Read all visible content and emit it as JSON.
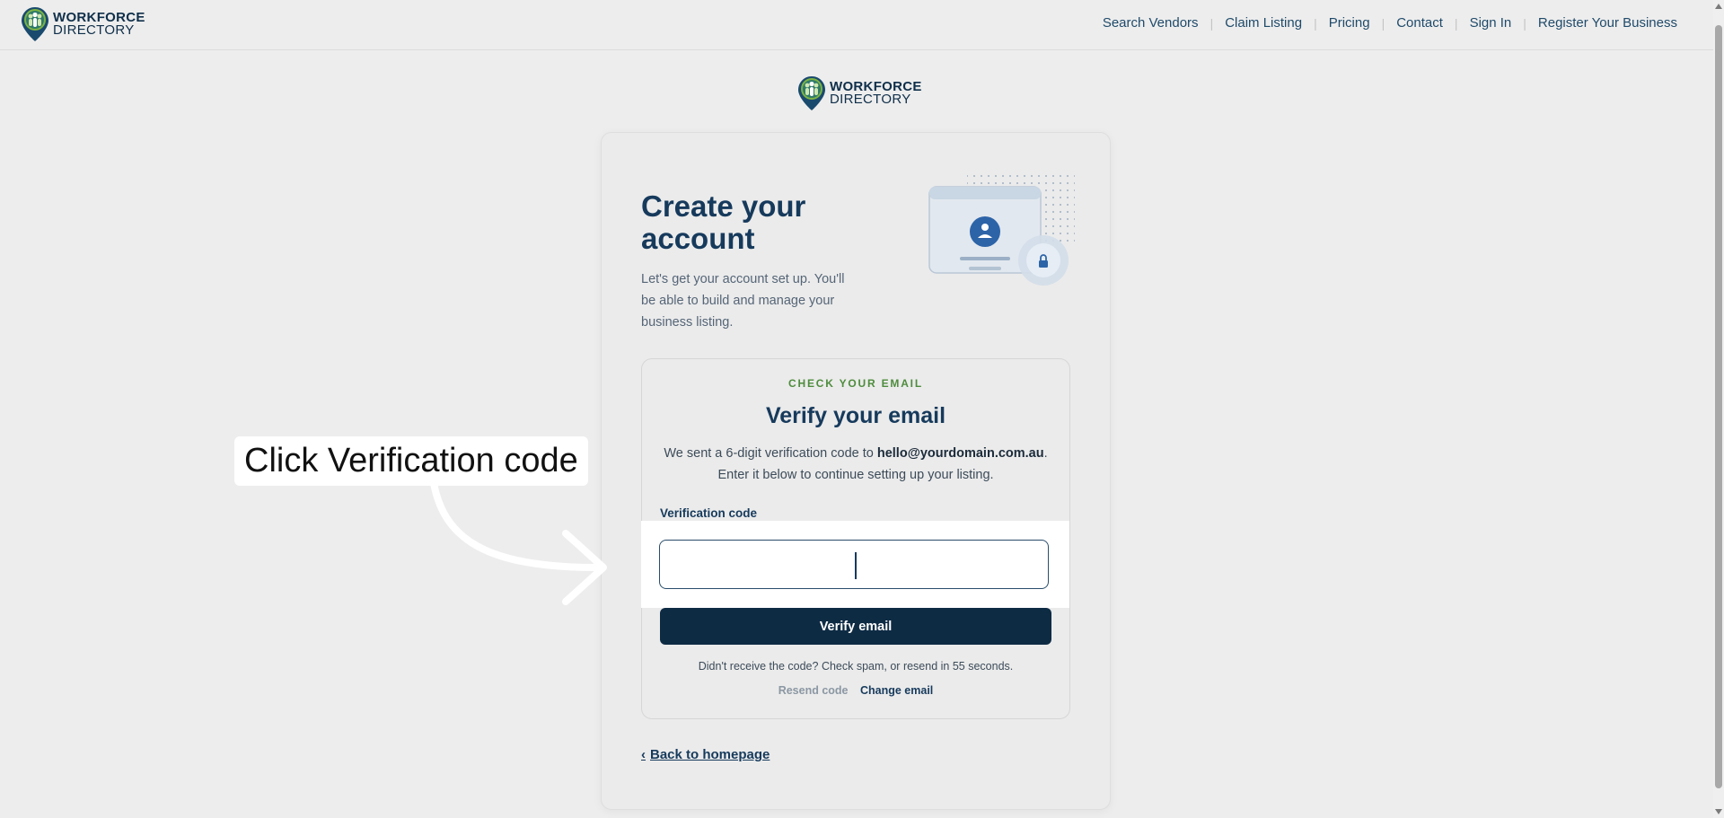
{
  "brand": {
    "line1": "WORKFORCE",
    "line2": "DIRECTORY"
  },
  "nav": {
    "items": [
      {
        "label": "Search Vendors"
      },
      {
        "label": "Claim Listing"
      },
      {
        "label": "Pricing"
      },
      {
        "label": "Contact"
      },
      {
        "label": "Sign In"
      },
      {
        "label": "Register Your Business"
      }
    ]
  },
  "card": {
    "title": "Create your account",
    "subtitle": "Let's get your account set up. You'll be able to build and manage your business listing."
  },
  "verify": {
    "eyebrow": "CHECK YOUR EMAIL",
    "title": "Verify your email",
    "desc_prefix": "We sent a 6-digit verification code to ",
    "email": "hello@yourdomain.com.au",
    "desc_suffix": ".",
    "desc_line2": "Enter it below to continue setting up your listing.",
    "field_label": "Verification code",
    "code_value": "",
    "button_label": "Verify email",
    "hint": "Didn't receive the code? Check spam, or resend in 55 seconds.",
    "resend_label": "Resend code",
    "change_label": "Change email"
  },
  "back_label": "Back to homepage",
  "annotation": {
    "text": "Click Verification code"
  },
  "colors": {
    "primary": "#0e2b44",
    "heading": "#163a5c",
    "accent_green": "#4e8c3d",
    "background": "#ededed"
  },
  "icons": [
    "map-pin-people-logo",
    "chevron-left-icon",
    "user-icon",
    "lock-icon",
    "arrow-icon"
  ]
}
